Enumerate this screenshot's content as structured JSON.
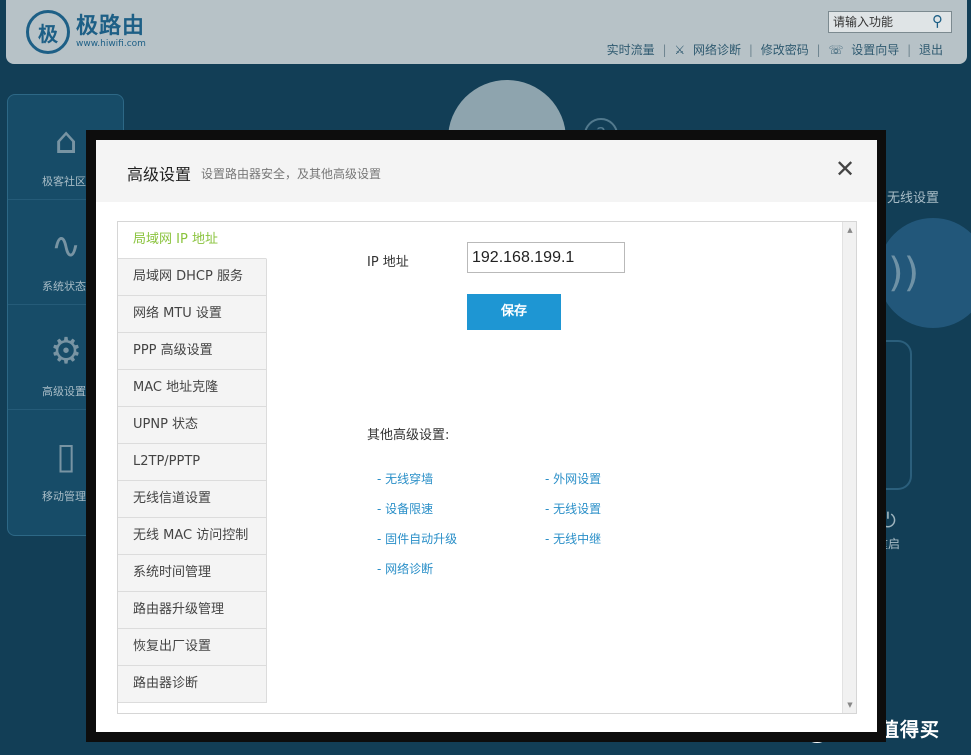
{
  "app": {
    "logo_mark": "极",
    "logo_name": "极路由",
    "logo_url": "www.hiwifi.com",
    "search_placeholder": "请输入功能",
    "top_links": [
      "实时流量",
      "网络诊断",
      "修改密码",
      "设置向导",
      "退出"
    ],
    "left_nav": [
      "极客社区",
      "系统状态",
      "高级设置",
      "移动管理"
    ],
    "wireless_settings": "无线设置",
    "reboot": "重启"
  },
  "watermark": {
    "badge": "值",
    "text": "什么值得买"
  },
  "modal": {
    "title": "高级设置",
    "subtitle": "设置路由器安全，及其他高级设置",
    "menu": [
      "局域网 IP 地址",
      "局域网 DHCP 服务",
      "网络 MTU 设置",
      "PPP 高级设置",
      "MAC 地址克隆",
      "UPNP 状态",
      "L2TP/PPTP",
      "无线信道设置",
      "无线 MAC 访问控制",
      "系统时间管理",
      "路由器升级管理",
      "恢复出厂设置",
      "路由器诊断"
    ],
    "active_index": 0,
    "ip_label": "IP 地址",
    "ip_value": "192.168.199.1",
    "save_label": "保存",
    "other_title": "其他高级设置:",
    "other_links": [
      "- 无线穿墙",
      "- 外网设置",
      "- 设备限速",
      "- 无线设置",
      "- 固件自动升级",
      "- 无线中继",
      "- 网络诊断"
    ]
  },
  "colors": {
    "accent": "#1e96d3",
    "active_menu": "#8ac33d",
    "link": "#2a8fc8"
  }
}
